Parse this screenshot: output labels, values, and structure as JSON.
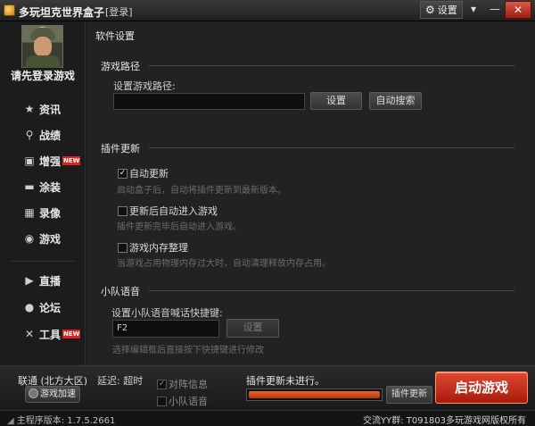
{
  "window": {
    "title": "多玩坦克世界盒子",
    "login_link": "[登录]",
    "settings_label": "设置",
    "settings_icon": "gear-icon",
    "menu_icon": "menu-icon",
    "minimize_icon": "minimize-icon",
    "close_icon": "close-icon"
  },
  "sidebar": {
    "login_prompt": "请先登录游戏",
    "items": [
      {
        "label": "资讯",
        "icon": "star-icon",
        "glyph": "★",
        "new": false
      },
      {
        "label": "战绩",
        "icon": "search-icon",
        "glyph": "🔍",
        "new": false
      },
      {
        "label": "增强",
        "icon": "toolbox-icon",
        "glyph": "▣",
        "new": true
      },
      {
        "label": "涂装",
        "icon": "tank-icon",
        "glyph": "▬",
        "new": false
      },
      {
        "label": "录像",
        "icon": "film-icon",
        "glyph": "▦",
        "new": false
      },
      {
        "label": "游戏",
        "icon": "gamepad-icon",
        "glyph": "◉",
        "new": false
      },
      {
        "label": "直播",
        "icon": "play-icon",
        "glyph": "▶",
        "new": false
      },
      {
        "label": "论坛",
        "icon": "chat-icon",
        "glyph": "●",
        "new": false
      },
      {
        "label": "工具",
        "icon": "tools-icon",
        "glyph": "✕",
        "new": true
      }
    ],
    "new_badge": "NEW"
  },
  "main": {
    "panel_title": "软件设置",
    "game_path": {
      "section": "游戏路径",
      "label": "设置游戏路径:",
      "value": "",
      "set_button": "设置",
      "auto_search_button": "自动搜索"
    },
    "plugin_update": {
      "section": "插件更新",
      "auto_update": {
        "label": "自动更新",
        "checked": true,
        "hint": "启动盒子后，自动将插件更新到最新版本。"
      },
      "enter_after_update": {
        "label": "更新后自动进入游戏",
        "checked": false,
        "hint": "插件更新完毕后自动进入游戏。"
      },
      "memory_cleanup": {
        "label": "游戏内存整理",
        "checked": false,
        "hint": "当游戏占用物理内存过大时，自动清理释放内存占用。"
      }
    },
    "team_voice": {
      "section": "小队语音",
      "label": "设置小队语音喊话快捷键:",
      "hotkey": "F2",
      "set_button": "设置",
      "hint": "选择编辑框后直接按下快捷键进行修改"
    }
  },
  "bottom": {
    "server": "联通 (北方大区)",
    "latency": "延迟: 超时",
    "accel_button": "游戏加速",
    "team_info": {
      "label": "对阵信息",
      "checked": true
    },
    "team_voice": {
      "label": "小队语音",
      "checked": false
    },
    "update_status": "插件更新未进行。",
    "progress": 1.0,
    "update_button": "插件更新",
    "launch_button": "启动游戏"
  },
  "status": {
    "version": "主程序版本: 1.7.5.2661",
    "qq_group": "交流YY群: T091803",
    "copyright": "多玩游戏网版权所有"
  },
  "colors": {
    "accent": "#c8321c",
    "progress": "#d4541f"
  }
}
